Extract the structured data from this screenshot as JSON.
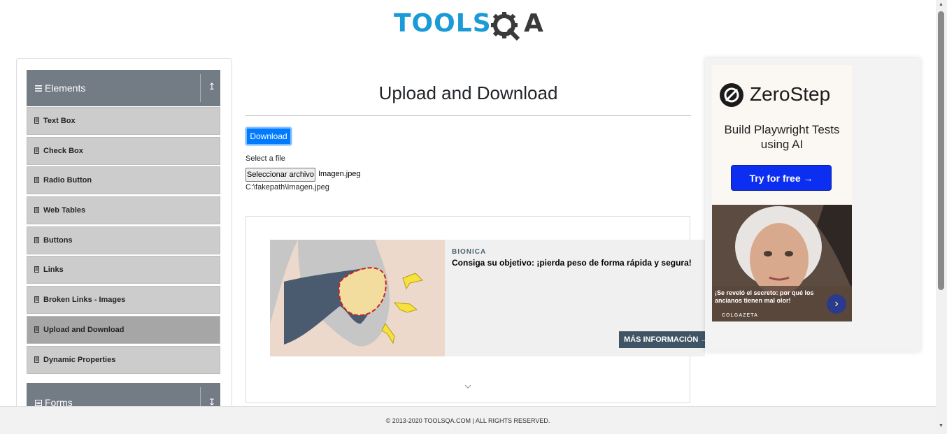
{
  "header": {
    "logo_left": "TOOLS",
    "logo_right": "A"
  },
  "sidebar": {
    "groups": [
      {
        "title": "Elements",
        "arrow": "↥"
      },
      {
        "title": "Forms",
        "arrow": "↧"
      }
    ],
    "items": [
      {
        "label": "Text Box"
      },
      {
        "label": "Check Box"
      },
      {
        "label": "Radio Button"
      },
      {
        "label": "Web Tables"
      },
      {
        "label": "Buttons"
      },
      {
        "label": "Links"
      },
      {
        "label": "Broken Links - Images"
      },
      {
        "label": "Upload and Download"
      },
      {
        "label": "Dynamic Properties"
      }
    ]
  },
  "main": {
    "title": "Upload and Download",
    "download_label": "Download",
    "select_label": "Select a file",
    "file_button_label": "Seleccionar archivo",
    "file_name": "Imagen.jpeg",
    "file_path": "C:\\fakepath\\Imagen.jpeg"
  },
  "center_ad": {
    "brand": "BIONICA",
    "headline": "Consiga su objetivo: ¡pierda peso de forma rápida y segura!",
    "cta": "MÁS INFORMACIÓN →"
  },
  "right_ad": {
    "brand_name": "ZeroStep",
    "subtitle": "Build Playwright Tests using AI",
    "button": "Try for free →",
    "caption": "¡Se reveló el secreto: por qué los ancianos tienen mal olor!",
    "caption_brand": "COLGAZETA",
    "next_arrow": "›"
  },
  "footer": {
    "text": "© 2013-2020 TOOLSQA.COM | ALL RIGHTS RESERVED."
  },
  "colors": {
    "accent": "#007bff",
    "sidebar_header": "#737b84",
    "logo_blue": "#1a9ad6"
  }
}
